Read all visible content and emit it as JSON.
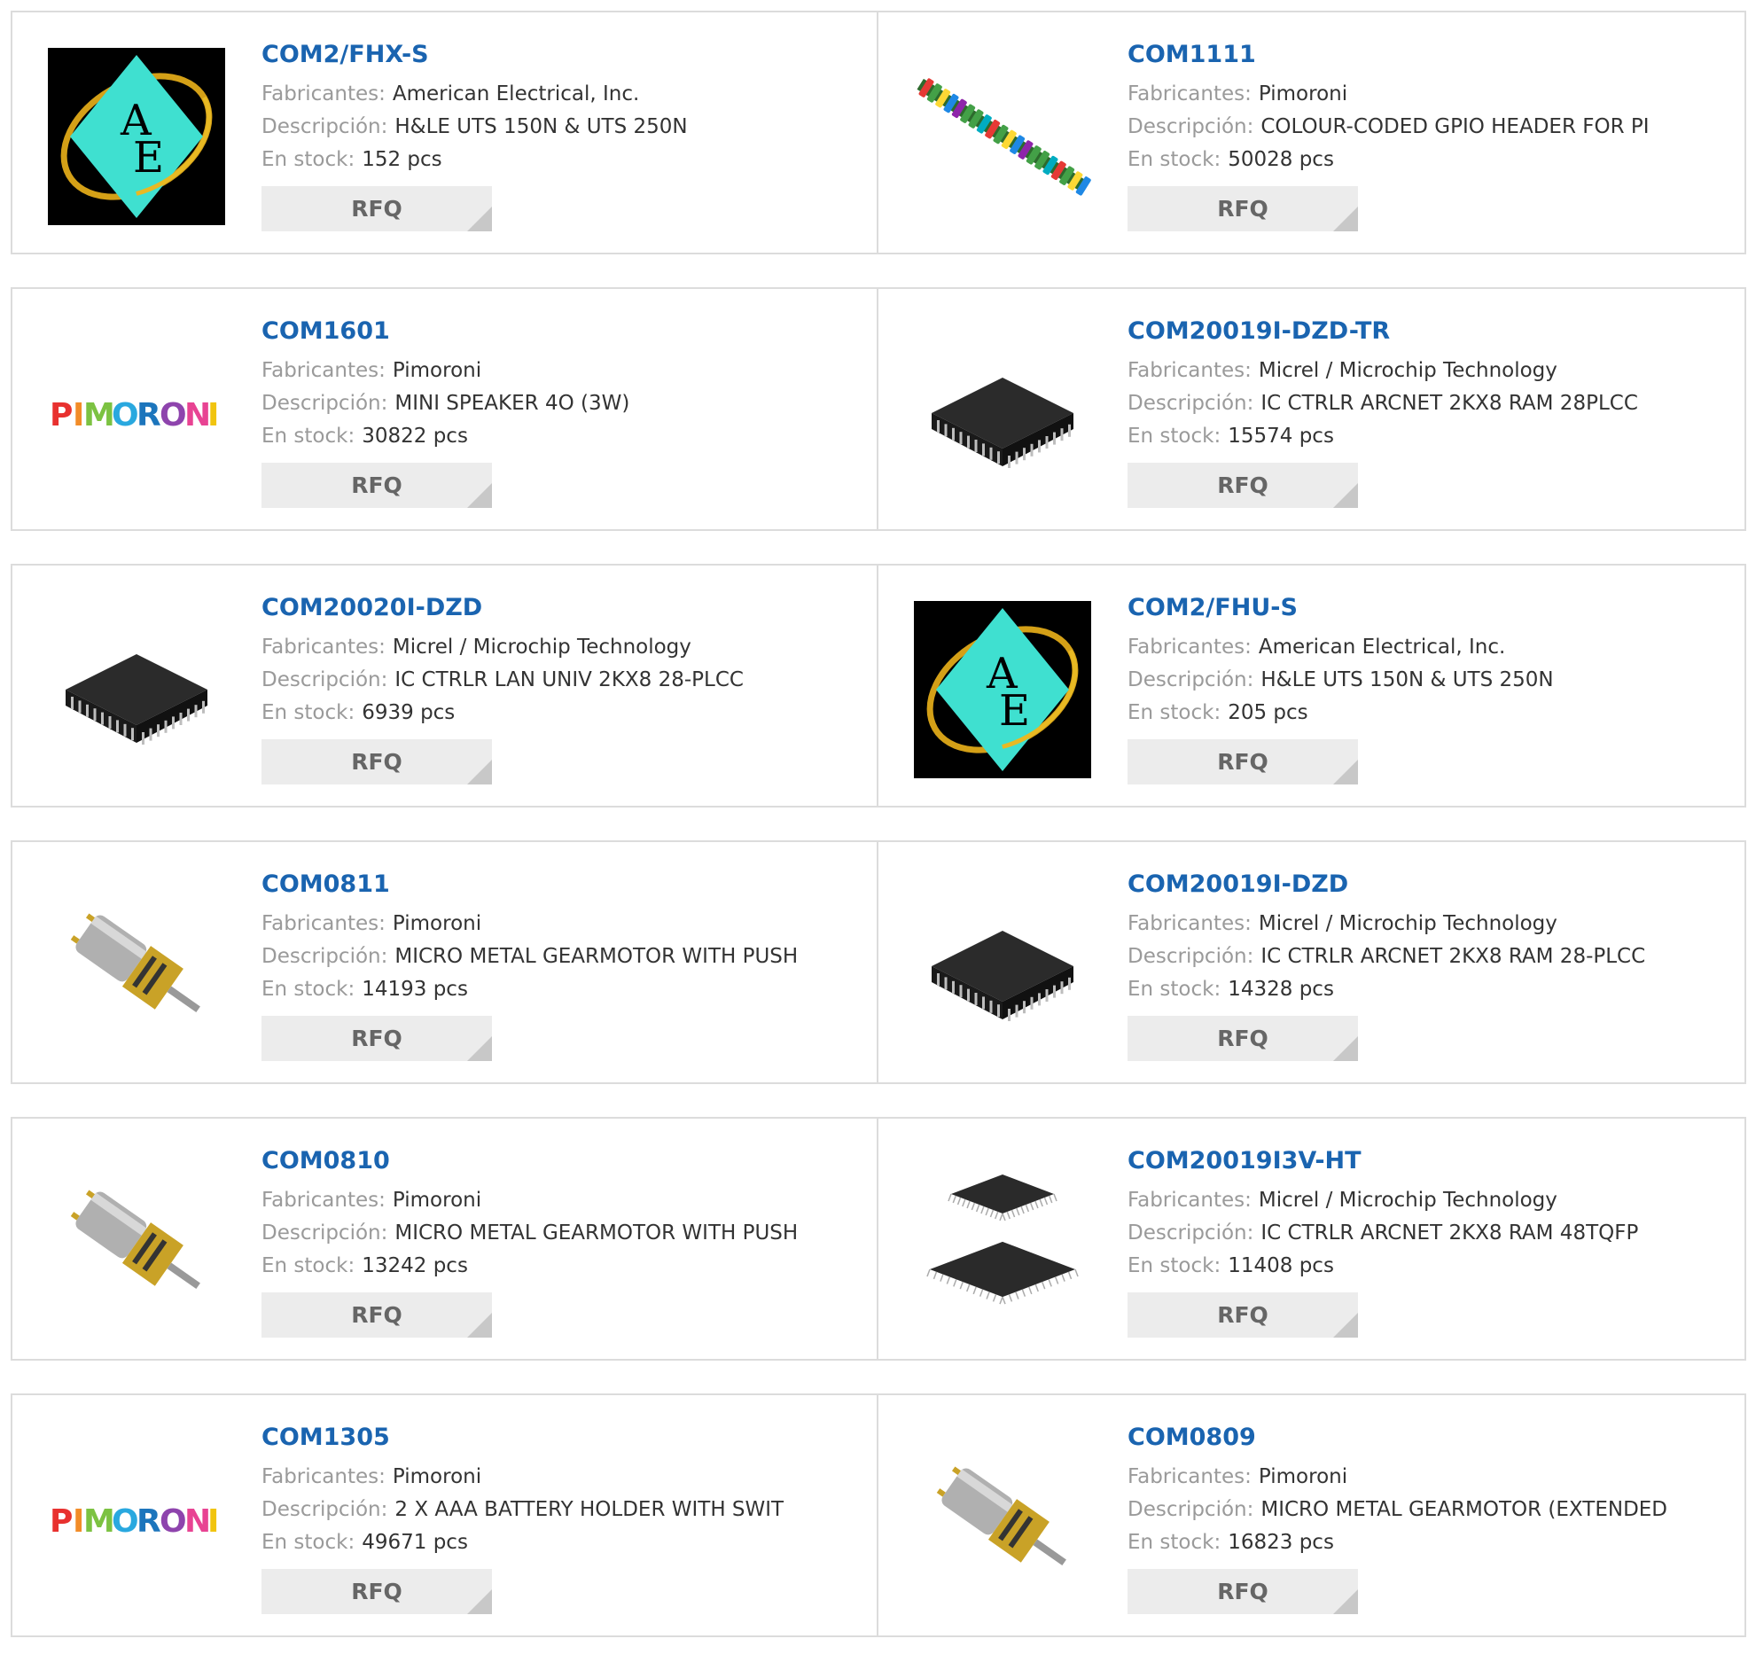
{
  "labels": {
    "manufacturer": "Fabricantes:",
    "description": "Descripción:",
    "stock": "En stock:",
    "rfq": "RFQ"
  },
  "brand_logo_text": "PIMORONI",
  "brand_logo_letters": [
    "P",
    "I",
    "M",
    "O",
    "R",
    "O",
    "N",
    "I"
  ],
  "brand_logo_colors": [
    "#e8312f",
    "#f28c28",
    "#7cc242",
    "#29a8df",
    "#1c75bc",
    "#8e44ad",
    "#e84393",
    "#f1c40f"
  ],
  "ae_logo_letters": [
    "A",
    "E"
  ],
  "products": [
    {
      "part": "COM2/FHX-S",
      "manufacturer": "American Electrical, Inc.",
      "description": "H&LE UTS 150N & UTS 250N",
      "stock": "152 pcs",
      "image": "ae-logo"
    },
    {
      "part": "COM1111",
      "manufacturer": "Pimoroni",
      "description": "COLOUR-CODED GPIO HEADER FOR PI",
      "stock": "50028 pcs",
      "image": "gpio-header"
    },
    {
      "part": "COM1601",
      "manufacturer": "Pimoroni",
      "description": "MINI SPEAKER 4O (3W)",
      "stock": "30822 pcs",
      "image": "pimoroni-logo"
    },
    {
      "part": "COM20019I-DZD-TR",
      "manufacturer": "Micrel / Microchip Technology",
      "description": "IC CTRLR ARCNET 2KX8 RAM 28PLCC",
      "stock": "15574 pcs",
      "image": "plcc-chip"
    },
    {
      "part": "COM20020I-DZD",
      "manufacturer": "Micrel / Microchip Technology",
      "description": "IC CTRLR LAN UNIV 2KX8 28-PLCC",
      "stock": "6939 pcs",
      "image": "plcc-chip"
    },
    {
      "part": "COM2/FHU-S",
      "manufacturer": "American Electrical, Inc.",
      "description": "H&LE UTS 150N & UTS 250N",
      "stock": "205 pcs",
      "image": "ae-logo"
    },
    {
      "part": "COM0811",
      "manufacturer": "Pimoroni",
      "description": "MICRO METAL GEARMOTOR WITH PUSH",
      "stock": "14193 pcs",
      "image": "gearmotor"
    },
    {
      "part": "COM20019I-DZD",
      "manufacturer": "Micrel / Microchip Technology",
      "description": "IC CTRLR ARCNET 2KX8 RAM 28-PLCC",
      "stock": "14328 pcs",
      "image": "plcc-chip"
    },
    {
      "part": "COM0810",
      "manufacturer": "Pimoroni",
      "description": "MICRO METAL GEARMOTOR WITH PUSH",
      "stock": "13242 pcs",
      "image": "gearmotor"
    },
    {
      "part": "COM20019I3V-HT",
      "manufacturer": "Micrel / Microchip Technology",
      "description": "IC CTRLR ARCNET 2KX8 RAM 48TQFP",
      "stock": "11408 pcs",
      "image": "tqfp-chip"
    },
    {
      "part": "COM1305",
      "manufacturer": "Pimoroni",
      "description": "2 X AAA BATTERY HOLDER WITH SWIT",
      "stock": "49671 pcs",
      "image": "pimoroni-logo"
    },
    {
      "part": "COM0809",
      "manufacturer": "Pimoroni",
      "description": "MICRO METAL GEARMOTOR (EXTENDED",
      "stock": "16823 pcs",
      "image": "gearmotor"
    }
  ]
}
